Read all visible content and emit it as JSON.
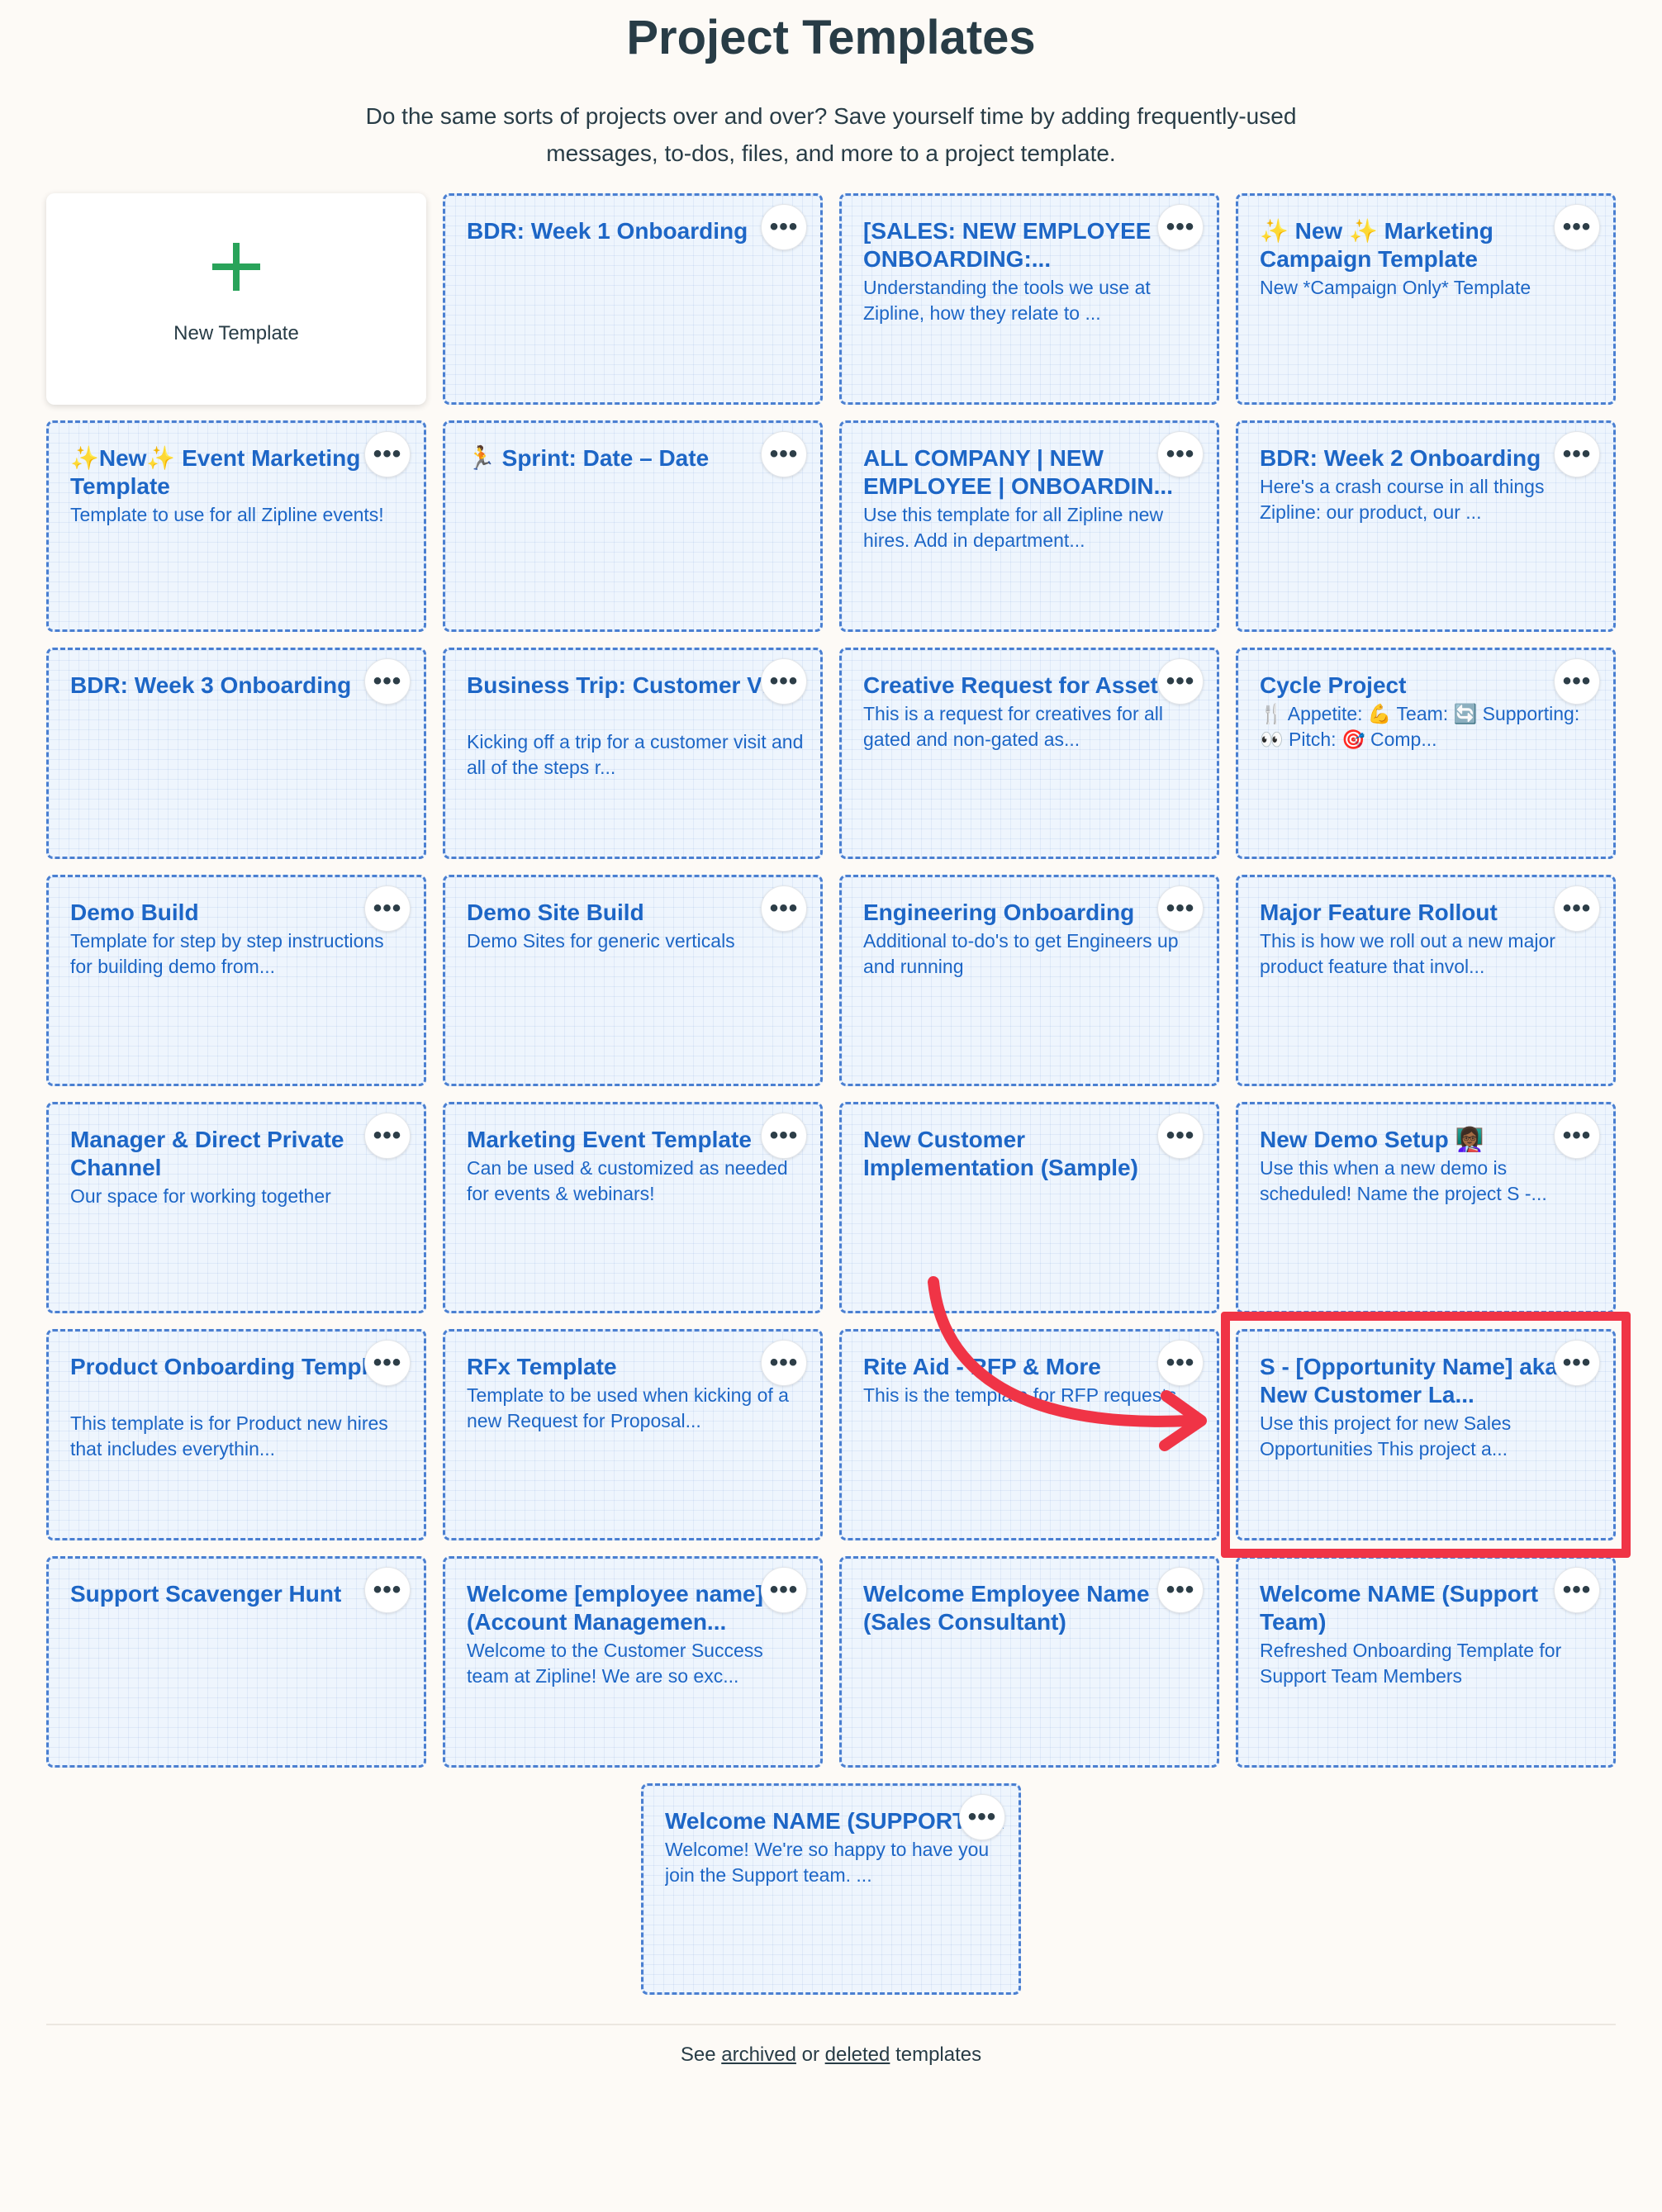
{
  "page": {
    "title": "Project Templates",
    "description": "Do the same sorts of projects over and over? Save yourself time by adding frequently-used messages, to-dos, files, and more to a project template."
  },
  "new_template": {
    "label": "New Template",
    "icon": "plus-icon",
    "icon_color": "#29a35a"
  },
  "menu_glyph": "•••",
  "templates": [
    {
      "title": "BDR: Week 1 Onboarding",
      "desc": ""
    },
    {
      "title": "[SALES: NEW EMPLOYEE ONBOARDING:...",
      "desc": "Understanding the tools we use at Zipline, how they relate to ..."
    },
    {
      "title": "✨ New ✨ Marketing Campaign Template",
      "desc": "New *Campaign Only* Template"
    },
    {
      "title": "✨New✨ Event Marketing Template",
      "desc": "Template to use for all Zipline events!"
    },
    {
      "title": "🏃 Sprint: Date – Date",
      "desc": ""
    },
    {
      "title": "ALL COMPANY | NEW EMPLOYEE | ONBOARDIN...",
      "desc": "Use this template for all Zipline new hires. Add in department..."
    },
    {
      "title": "BDR: Week 2 Onboarding",
      "desc": "Here's a crash course in all things Zipline: our product, our ..."
    },
    {
      "title": "BDR: Week 3 Onboarding",
      "desc": ""
    },
    {
      "title": "Business Trip: Customer Visit",
      "desc": "Kicking off a trip for a customer visit and all of the steps r..."
    },
    {
      "title": "Creative Request for Asset",
      "desc": "This is a request for creatives for all gated and non-gated as..."
    },
    {
      "title": "Cycle Project",
      "desc": "🍴 Appetite: 💪 Team: 🔄 Supporting: 👀 Pitch: 🎯 Comp..."
    },
    {
      "title": "Demo Build",
      "desc": "Template for step by step instructions for building demo from..."
    },
    {
      "title": "Demo Site Build",
      "desc": "Demo Sites for generic verticals"
    },
    {
      "title": "Engineering Onboarding",
      "desc": "Additional to-do's to get Engineers up and running"
    },
    {
      "title": "Major Feature Rollout",
      "desc": "This is how we roll out a new major product feature that invol..."
    },
    {
      "title": "Manager & Direct Private Channel",
      "desc": "Our space for working together"
    },
    {
      "title": "Marketing Event Template",
      "desc": "Can be used & customized as needed for events & webinars!"
    },
    {
      "title": "New Customer Implementation (Sample)",
      "desc": ""
    },
    {
      "title": "New Demo Setup 👩🏾‍🏫",
      "desc": "Use this when a new demo is scheduled! Name the project S -..."
    },
    {
      "title": "Product Onboarding Template",
      "desc": "This template is for Product new hires that includes everythin..."
    },
    {
      "title": "RFx Template",
      "desc": "Template to be used when kicking of a new Request for Proposal..."
    },
    {
      "title": "Rite Aid - RFP & More",
      "desc": "This is the template for RFP requests"
    },
    {
      "title": "S - [Opportunity Name] aka New Customer La...",
      "desc": "Use this project for new Sales Opportunities This project a..."
    },
    {
      "title": "Support Scavenger Hunt",
      "desc": ""
    },
    {
      "title": "Welcome [employee name] (Account Managemen...",
      "desc": "Welcome to the Customer Success team at Zipline! We are so exc..."
    },
    {
      "title": "Welcome Employee Name (Sales Consultant)",
      "desc": ""
    },
    {
      "title": "Welcome NAME (Support Team)",
      "desc": "Refreshed Onboarding Template for Support Team Members"
    },
    {
      "title": "Welcome NAME (SUPPORT TEAM)",
      "desc": "Welcome! We're so happy to have you join the Support team. ..."
    }
  ],
  "footer": {
    "see": "See",
    "archived": "archived",
    "or": "or",
    "deleted": "deleted",
    "templates": "templates"
  },
  "annotation": {
    "highlight_color": "#f03446",
    "highlighted_template": "S - [Opportunity Name] aka New Customer La..."
  }
}
